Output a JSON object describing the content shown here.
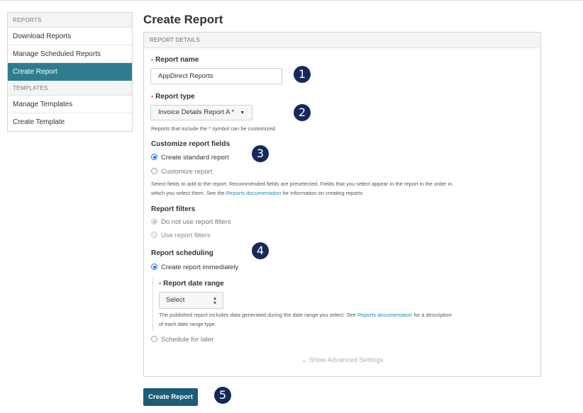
{
  "sidebar": {
    "sections": [
      {
        "header": "REPORTS",
        "items": [
          "Download Reports",
          "Manage Scheduled Reports",
          "Create Report"
        ]
      },
      {
        "header": "TEMPLATES",
        "items": [
          "Manage Templates",
          "Create Template"
        ]
      }
    ],
    "active_item": "Create Report"
  },
  "page": {
    "title": "Create Report"
  },
  "panel": {
    "header": "REPORT DETAILS"
  },
  "form": {
    "report_name": {
      "required_mark": "•",
      "label": "Report name",
      "value": "AppDirect Reports"
    },
    "report_type": {
      "required_mark": "•",
      "label": "Report type",
      "value": "Invoice Details Report A *",
      "caret": "▼",
      "help": "Reports that include the * symbol can be customized."
    },
    "customize": {
      "label": "Customize report fields",
      "options": [
        "Create standard report",
        "Customize report"
      ],
      "selected": "Create standard report",
      "help_1": "Select fields to add to the report. Recommended fields are preselected. Fields that you select appear in the report in the order in",
      "help_2_prefix": "which you select them. See the ",
      "help_2_link": "Reports documentation",
      "help_2_suffix": " for information on creating reports"
    },
    "filters": {
      "label": "Report filters",
      "options": [
        "Do not use report filters",
        "Use report filters"
      ],
      "selected": "Do not use report filters",
      "disabled": true
    },
    "scheduling": {
      "label": "Report scheduling",
      "options": [
        "Create report immediately",
        "Schedule for later"
      ],
      "selected": "Create report immediately",
      "date_range": {
        "required_mark": "•",
        "label": "Report date range",
        "value": "Select",
        "help_1_prefix": "The published report includes data generated during the date range you select. See ",
        "help_1_link": "Reports documentation",
        "help_1_suffix": " for a description",
        "help_2": "of each date range type."
      }
    },
    "advanced": {
      "chevron": "⌄",
      "label": "Show Advanced Settings"
    }
  },
  "actions": {
    "create_label": "Create Report"
  },
  "callouts": [
    "1",
    "2",
    "3",
    "4",
    "5"
  ],
  "colors": {
    "accent": "#2d7d8f",
    "primary_button": "#1c5c78",
    "callout": "#15295a",
    "link": "#1a8bb5",
    "required": "#e05a4f"
  }
}
